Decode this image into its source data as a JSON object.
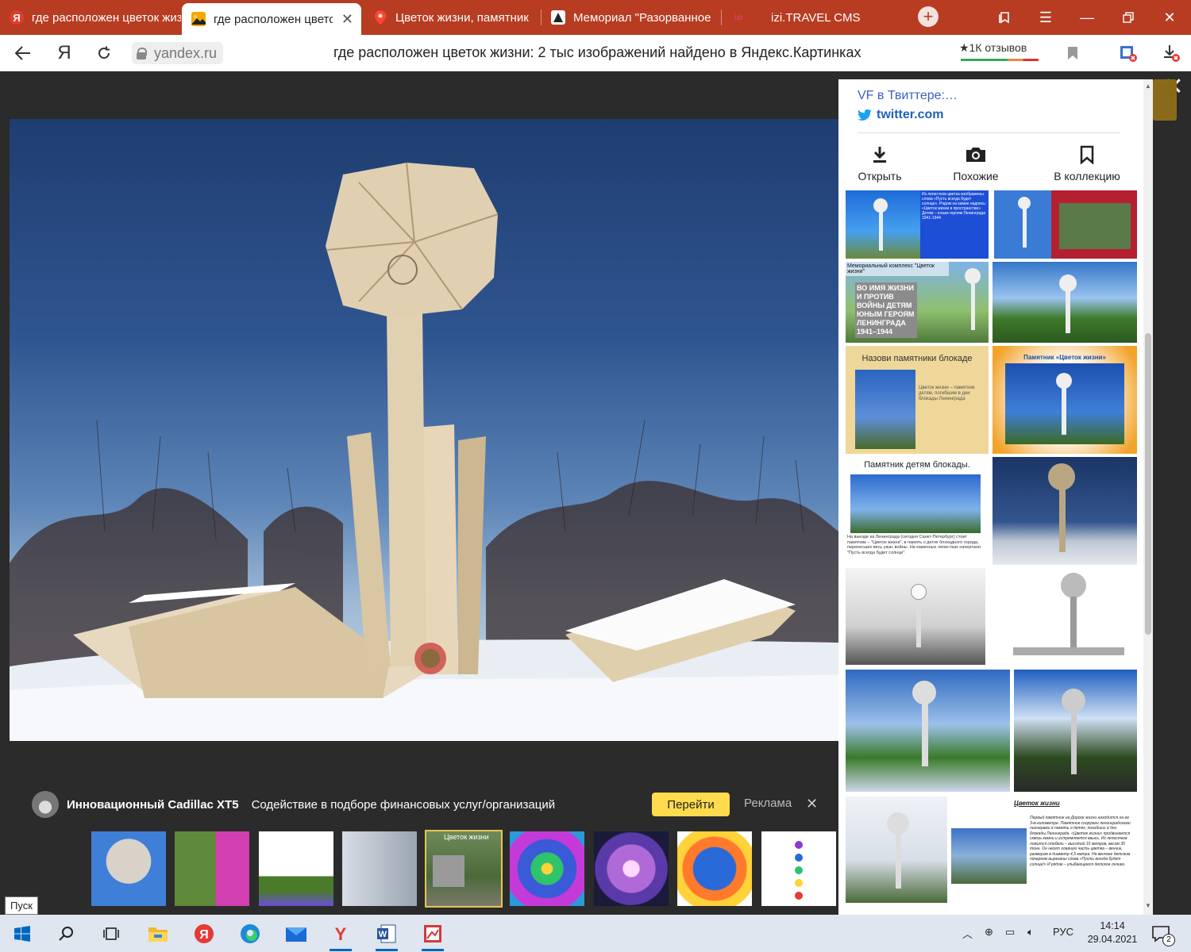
{
  "browser": {
    "tabs": [
      {
        "label": "где расположен цветок жизни",
        "fav": "Я",
        "fav_color": "#e03d2e",
        "active": false
      },
      {
        "label": "где расположен цветок жизни",
        "fav": "",
        "fav_color": "#f5a800",
        "active": true
      },
      {
        "label": "Цветок жизни, памятник",
        "fav": "",
        "fav_color": "#e03d2e",
        "active": false
      },
      {
        "label": "Мемориал \"Разорванное кольцо\"",
        "fav": "",
        "fav_color": "#222222",
        "active": false
      },
      {
        "label": "izi.TRAVEL CMS",
        "fav": "",
        "fav_color": "#e03d6e",
        "active": false
      }
    ],
    "new_tab_label": "+",
    "address": {
      "domain": "yandex.ru",
      "page_title": "где расположен цветок жизни: 2 тыс изображений найдено в Яндекс.Картинках",
      "reviews": "★1К отзывов"
    },
    "colors": {
      "tabbar": "#b73c22",
      "accent": "#ffdb4d"
    }
  },
  "viewer": {
    "close_label": "✕"
  },
  "panel": {
    "source_title": "VF в Твиттере:…",
    "source_domain": "twitter.com",
    "actions": [
      {
        "label": "Открыть",
        "icon": "download-icon"
      },
      {
        "label": "Похожие",
        "icon": "camera-icon"
      },
      {
        "label": "В коллекцию",
        "icon": "bookmark-icon"
      }
    ],
    "grid_texts": {
      "card_memorial_caption": "Мемориальный комплекс \"Цветок жизни\"",
      "card_memorial_stone": "ВО ИМЯ ЖИЗНИ И ПРОТИВ ВОЙНЫ ДЕТЯМ ЮНЫМ ГЕРОЯМ ЛЕНИНГРАДА 1941–1944",
      "card_name_title": "Назови памятники блокаде",
      "card_name_body": "Цветок жизни – памятник детям, погибшим в дни блокады Ленинграда",
      "card_yellow_title": "Памятник «Цветок жизни»",
      "card_children_title": "Памятник детям блокады.",
      "card_children_body": "На выезде из Ленинграда (сегодня Санкт-Петербург) стоит памятник – \"Цветок жизни\", в память о детях блокадного города, перенесших весь ужас войны. На каменных лепестках начертано: \"Пусть всегда будет солнце\".",
      "card_text_title": "Цветок жизни",
      "card_text_body": "Первый памятник на Дороге жизни находится на ее 3-м километре. Памятник сооружен ленинградскими пионерами в память о детях, погибших в дни блокады Ленинграда. «Цветок жизни» продвигается сквозь камни и устремляется ввысь. Из лепестков ложится стебель – высотой 15 метров, весом 35 тонн. Он несет главную часть цветка – венчик, размером в диаметр 4,5 метра. На венчике детским почерком вырезаны слова «Пусть всегда будет солнце!» И рядом – улыбающееся детское личико.",
      "card_top_blue": "Из лепестков цветка изображены слова «Пусть всегда будет солнце». Рядом на камне надпись: «Цветок жизни в пространстве» Детям – юным героям Ленинграда 1941-1944"
    }
  },
  "ad": {
    "name": "Инновационный Cadillac XT5",
    "text": "Содействие в подборе финансовых услуг/организаций",
    "go_label": "Перейти",
    "tag": "Реклама",
    "close": "✕"
  },
  "thumbs": {
    "selected_caption": "Цветок жизни"
  },
  "tooltip": "Пуск",
  "taskbar": {
    "lang": "РУС",
    "time": "14:14",
    "date": "29.04.2021",
    "notif_count": "2"
  }
}
